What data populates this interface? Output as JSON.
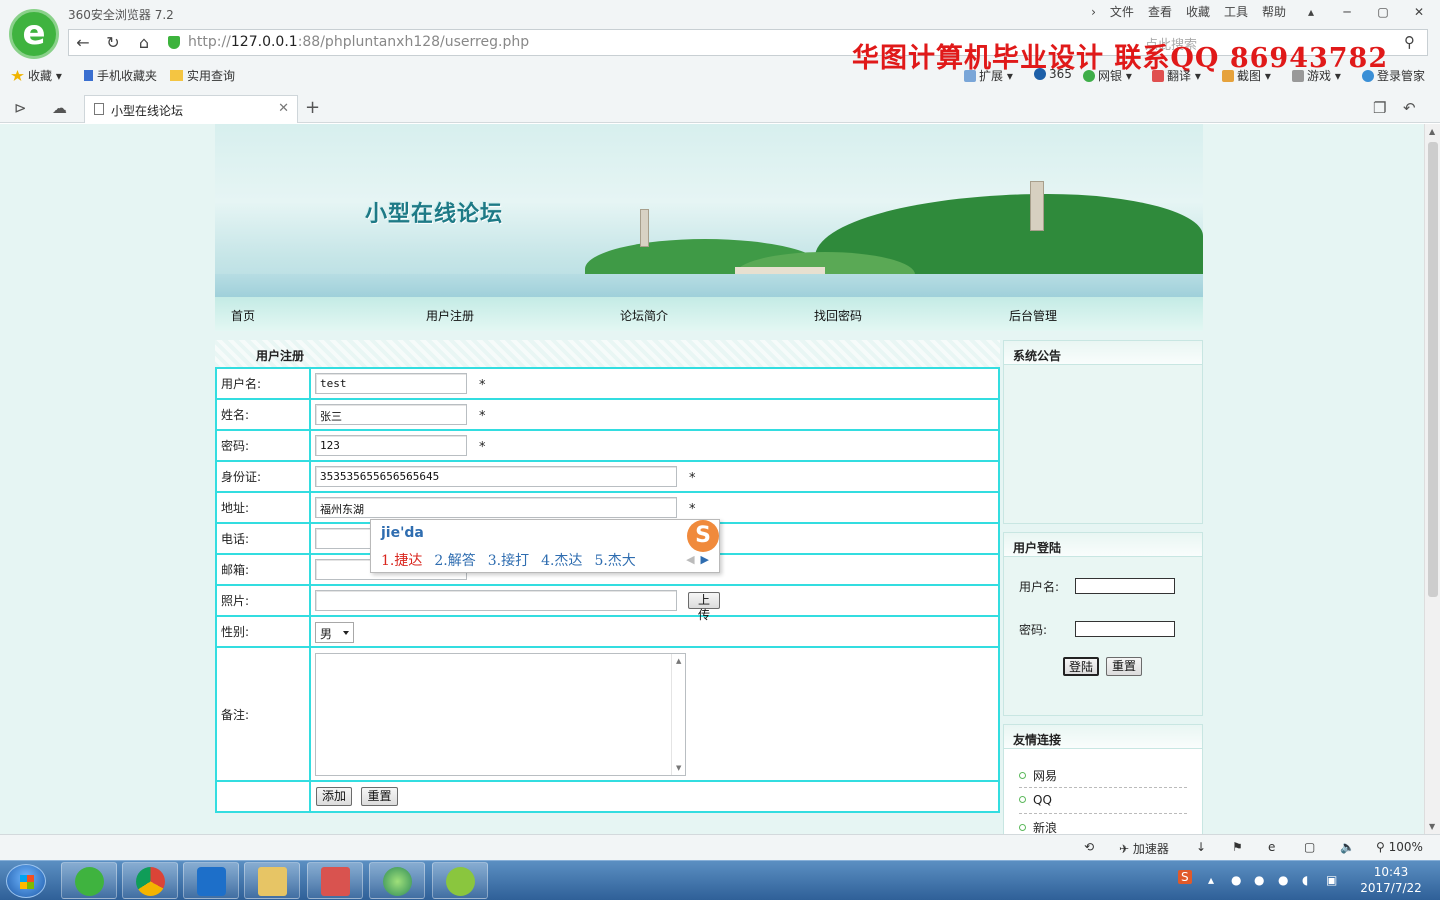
{
  "browser": {
    "window_title": "360安全浏览器 7.2",
    "top_menu": [
      "文件",
      "查看",
      "收藏",
      "工具",
      "帮助"
    ],
    "url_prefix": "http://",
    "url_host": "127.0.0.1",
    "url_rest": ":88/phpluntanxh128/userreg.php",
    "search_placeholder": "点此搜索",
    "promo_text": "华图计算机毕业设计  联系QQ   86943782",
    "bookmarks": [
      "收藏",
      "手机收藏夹",
      "实用查询"
    ],
    "extensions": [
      "扩展",
      "365",
      "网银",
      "翻译",
      "截图",
      "游戏",
      "登录管家"
    ],
    "tab_title": "小型在线论坛"
  },
  "site": {
    "title": "小型在线论坛",
    "nav": [
      "首页",
      "用户注册",
      "论坛简介",
      "找回密码",
      "后台管理"
    ]
  },
  "form": {
    "heading": "用户注册",
    "fields": {
      "username": {
        "label": "用户名:",
        "value": "test"
      },
      "name": {
        "label": "姓名:",
        "value": "张三"
      },
      "password": {
        "label": "密码:",
        "value": "123"
      },
      "idcard": {
        "label": "身份证:",
        "value": "353535655656565645"
      },
      "address": {
        "label": "地址:",
        "value": "福州东湖"
      },
      "phone": {
        "label": "电话:",
        "value": ""
      },
      "email": {
        "label": "邮箱:",
        "value": ""
      },
      "photo": {
        "label": "照片:",
        "value": "",
        "button": "上传"
      },
      "gender": {
        "label": "性别:",
        "value": "男"
      },
      "remark": {
        "label": "备注:",
        "value": ""
      }
    },
    "required_mark": "*",
    "submit_label": "添加",
    "reset_label": "重置"
  },
  "ime": {
    "pinyin": "jie'da",
    "candidates": [
      "1.捷达",
      "2.解答",
      "3.接打",
      "4.杰达",
      "5.杰大"
    ]
  },
  "sidebar": {
    "notice_title": "系统公告",
    "login_title": "用户登陆",
    "login_user_label": "用户名:",
    "login_pass_label": "密码:",
    "login_button": "登陆",
    "login_reset": "重置",
    "links_title": "友情连接",
    "links": [
      "网易",
      "QQ",
      "新浪"
    ]
  },
  "statusbar": {
    "accelerator": "加速器",
    "zoom": "100%"
  },
  "taskbar": {
    "time": "10:43",
    "date": "2017/7/22"
  }
}
